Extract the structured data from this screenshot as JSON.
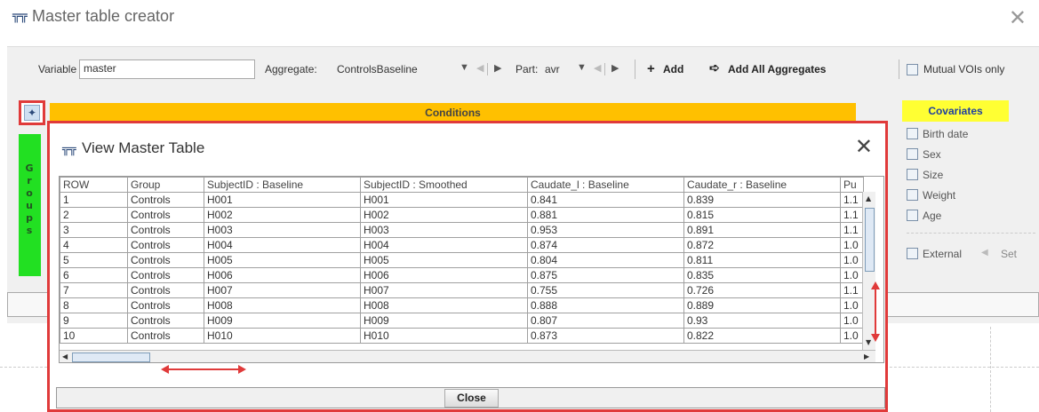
{
  "window": {
    "icon": "table-icon",
    "title": "Master table creator",
    "close_glyph": "✕"
  },
  "toolbar": {
    "variable_label": "Variable",
    "variable_value": "master",
    "aggregate_label": "Aggregate:",
    "aggregate_value": "ControlsBaseline",
    "part_label": "Part:",
    "part_value": "avr",
    "add_label": "Add",
    "add_all_label": "Add All Aggregates",
    "mutual_label": "Mutual VOIs only"
  },
  "groups": {
    "letters": [
      "G",
      "r",
      "o",
      "u",
      "p",
      "s"
    ]
  },
  "conditions": {
    "label": "Conditions"
  },
  "covariates": {
    "header": "Covariates",
    "items": [
      "Birth date",
      "Sex",
      "Size",
      "Weight",
      "Age"
    ],
    "external_label": "External",
    "set_label": "Set"
  },
  "dialog": {
    "icon": "table-icon",
    "title": "View Master Table",
    "close_glyph": "✕",
    "close_button": "Close",
    "columns": [
      "ROW",
      "Group",
      "SubjectID : Baseline",
      "SubjectID : Smoothed",
      "Caudate_l : Baseline",
      "Caudate_r : Baseline",
      "Pu"
    ],
    "rows": [
      [
        "1",
        "Controls",
        "H001",
        "H001",
        "0.841",
        "0.839",
        "1.1"
      ],
      [
        "2",
        "Controls",
        "H002",
        "H002",
        "0.881",
        "0.815",
        "1.1"
      ],
      [
        "3",
        "Controls",
        "H003",
        "H003",
        "0.953",
        "0.891",
        "1.1"
      ],
      [
        "4",
        "Controls",
        "H004",
        "H004",
        "0.874",
        "0.872",
        "1.0"
      ],
      [
        "5",
        "Controls",
        "H005",
        "H005",
        "0.804",
        "0.811",
        "1.0"
      ],
      [
        "6",
        "Controls",
        "H006",
        "H006",
        "0.875",
        "0.835",
        "1.0"
      ],
      [
        "7",
        "Controls",
        "H007",
        "H007",
        "0.755",
        "0.726",
        "1.1"
      ],
      [
        "8",
        "Controls",
        "H008",
        "H008",
        "0.888",
        "0.889",
        "1.0"
      ],
      [
        "9",
        "Controls",
        "H009",
        "H009",
        "0.807",
        "0.93",
        "1.0"
      ],
      [
        "10",
        "Controls",
        "H010",
        "H010",
        "0.873",
        "0.822",
        "1.0"
      ]
    ]
  },
  "colors": {
    "highlight_red": "#e03a3a",
    "groups_green": "#22e022",
    "conditions_orange": "#ffc000",
    "covariates_yellow": "#ffff33"
  }
}
